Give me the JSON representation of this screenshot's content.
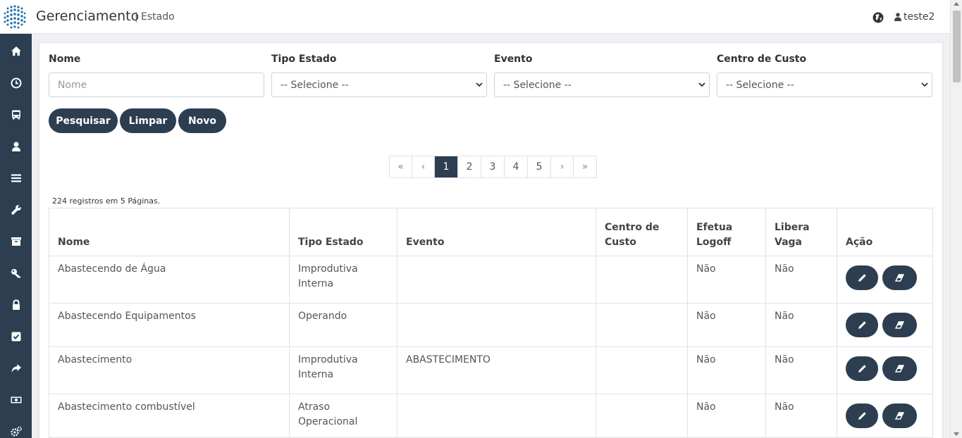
{
  "header": {
    "title": "Gerenciamento",
    "separator": "|",
    "subtitle": "Estado",
    "user": "teste2"
  },
  "sidebar": {
    "items": [
      {
        "icon": "home-icon"
      },
      {
        "icon": "clock-icon"
      },
      {
        "icon": "bus-icon"
      },
      {
        "icon": "user-icon"
      },
      {
        "icon": "list-icon"
      },
      {
        "icon": "wrench-icon"
      },
      {
        "icon": "archive-icon"
      },
      {
        "icon": "key-icon"
      },
      {
        "icon": "lock-icon"
      },
      {
        "icon": "check-square-icon"
      },
      {
        "icon": "share-icon"
      },
      {
        "icon": "money-icon"
      },
      {
        "icon": "cogs-icon"
      }
    ]
  },
  "filters": {
    "nome_label": "Nome",
    "nome_placeholder": "Nome",
    "tipo_label": "Tipo Estado",
    "tipo_value": "-- Selecione --",
    "evento_label": "Evento",
    "evento_value": "-- Selecione --",
    "centro_label": "Centro de Custo",
    "centro_value": "-- Selecione --"
  },
  "buttons": {
    "search": "Pesquisar",
    "clear": "Limpar",
    "new": "Novo"
  },
  "pagination": {
    "first": "«",
    "prev": "‹",
    "pages": [
      "1",
      "2",
      "3",
      "4",
      "5"
    ],
    "active": "1",
    "next": "›",
    "last": "»"
  },
  "records_info": "224 registros em 5 Páginas.",
  "table": {
    "headers": {
      "nome": "Nome",
      "tipo": "Tipo Estado",
      "evento": "Evento",
      "centro": "Centro de Custo",
      "logoff": "Efetua Logoff",
      "vaga": "Libera Vaga",
      "acao": "Ação"
    },
    "rows": [
      {
        "nome": "Abastecendo de Água",
        "tipo": "Improdutiva Interna",
        "evento": "",
        "centro": "",
        "logoff": "Não",
        "vaga": "Não"
      },
      {
        "nome": "Abastecendo Equipamentos",
        "tipo": "Operando",
        "evento": "",
        "centro": "",
        "logoff": "Não",
        "vaga": "Não"
      },
      {
        "nome": "Abastecimento",
        "tipo": "Improdutiva Interna",
        "evento": "ABASTECIMENTO",
        "centro": "",
        "logoff": "Não",
        "vaga": "Não"
      },
      {
        "nome": "Abastecimento combustível",
        "tipo": "Atraso Operacional",
        "evento": "",
        "centro": "",
        "logoff": "Não",
        "vaga": "Não"
      }
    ]
  },
  "colors": {
    "primary": "#2c3e50",
    "sidebar": "#2c3e50"
  }
}
